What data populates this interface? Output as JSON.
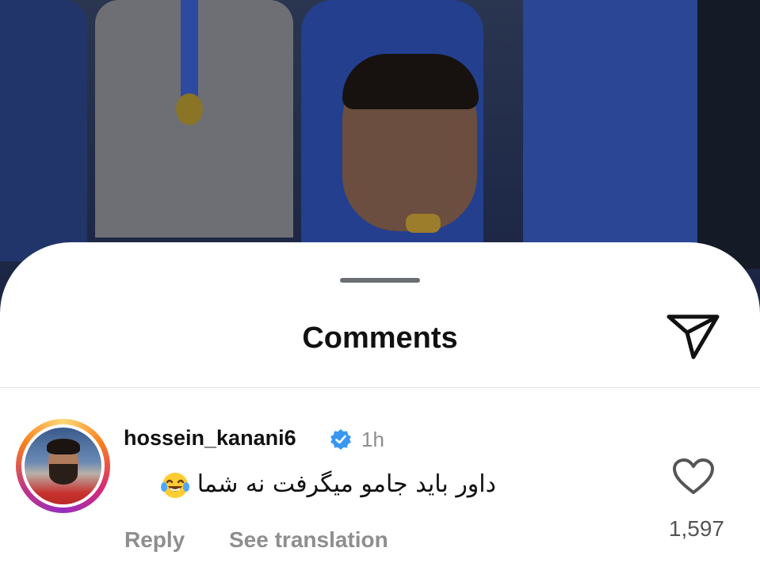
{
  "background": {
    "description_icon": "photo-background",
    "accent": "#1f2a48"
  },
  "sheet": {
    "title": "Comments",
    "share_icon": "paper-plane-icon"
  },
  "comments": [
    {
      "username": "hossein_kanani6",
      "verified": true,
      "time": "1h",
      "text": "داور باید جامو میگرفت نه شما",
      "emoji": "face-with-tears-of-joy",
      "reply_label": "Reply",
      "translate_label": "See translation",
      "likes": "1,597",
      "like_icon": "heart-icon"
    }
  ],
  "colors": {
    "verified_blue": "#3897f0",
    "muted_text": "#8e8e8e",
    "handle": "#6b6f74"
  }
}
